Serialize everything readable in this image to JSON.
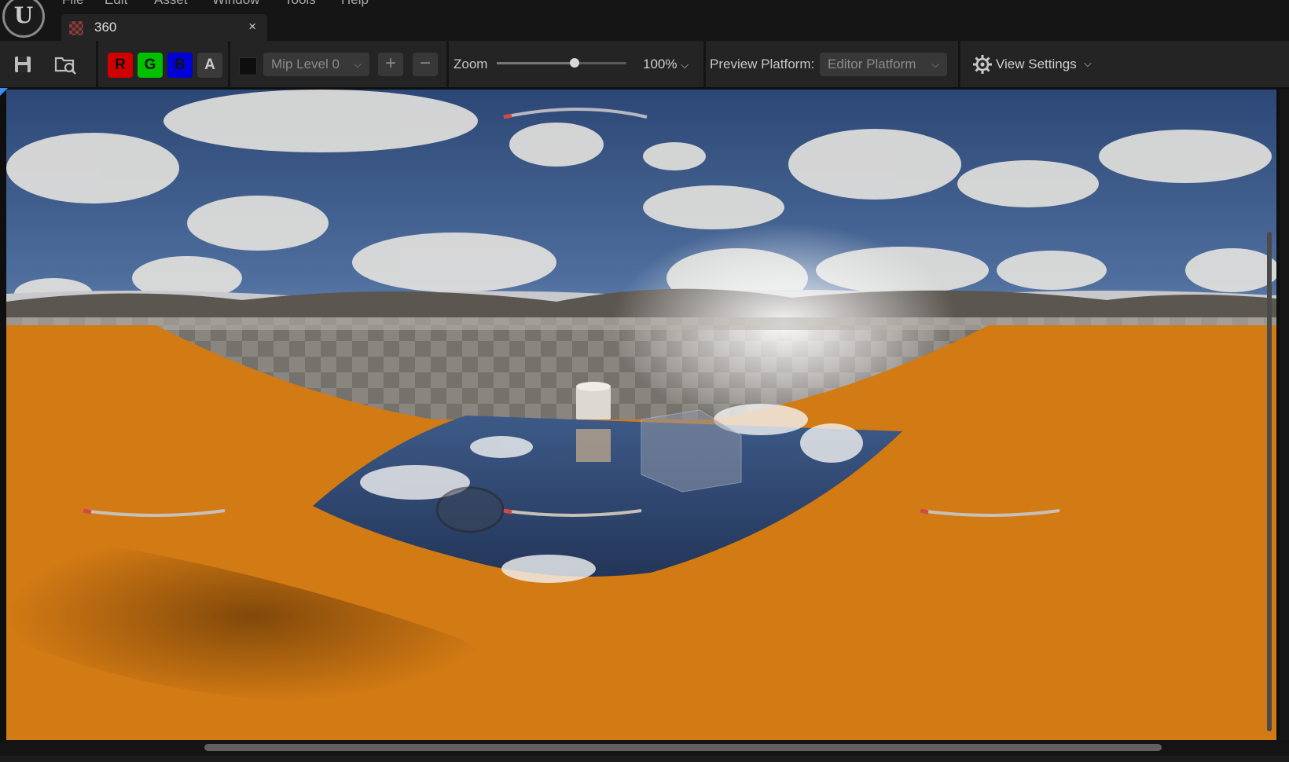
{
  "app": {
    "logo_glyph": "U"
  },
  "menu": [
    "File",
    "Edit",
    "Asset",
    "Window",
    "Tools",
    "Help"
  ],
  "tab": {
    "title": "360",
    "icon": "texture-icon",
    "close_glyph": "×"
  },
  "toolbar": {
    "save_icon": "save-icon",
    "browse_icon": "browse-asset-icon",
    "channels": [
      {
        "label": "R",
        "bg": "#d00000",
        "fg": "#111111"
      },
      {
        "label": "G",
        "bg": "#00c000",
        "fg": "#111111"
      },
      {
        "label": "B",
        "bg": "#0000d8",
        "fg": "#111111"
      },
      {
        "label": "A",
        "bg": "#3a3a3a",
        "fg": "#cccccc"
      }
    ],
    "mip_level": "Mip Level 0",
    "zoom_label": "Zoom",
    "zoom_value": "100%",
    "zoom_slider_fraction": 0.6,
    "preview_platform_label": "Preview Platform:",
    "preview_platform_value": "Editor Platform",
    "view_settings": "View Settings"
  },
  "colors": {
    "accent": "#3b8cf0",
    "ground_orange": "#d27a14",
    "sky_blue": "#3c5b8c"
  }
}
